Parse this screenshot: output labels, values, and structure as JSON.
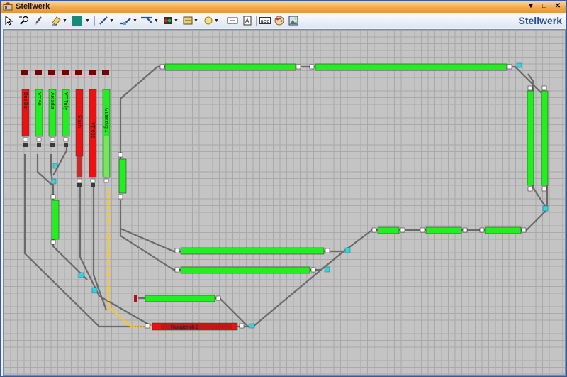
{
  "window": {
    "title": "Stellwerk",
    "minimize_glyph": "▾",
    "maximize_glyph": "□",
    "close_glyph": "✕"
  },
  "toolbar": {
    "app_label": "Stellwerk",
    "tools": [
      {
        "name": "select-pointer-icon"
      },
      {
        "name": "zoom-tool-icon"
      },
      {
        "name": "pencil-icon"
      },
      {
        "name": "eraser-icon"
      },
      {
        "name": "fill-color-icon",
        "color": "#1a8a78"
      },
      {
        "name": "line-tool-icon"
      },
      {
        "name": "track-straight-icon"
      },
      {
        "name": "track-switch-icon"
      },
      {
        "name": "signal-icon"
      },
      {
        "name": "block-icon"
      },
      {
        "name": "circle-icon"
      },
      {
        "name": "text-frame-icon"
      },
      {
        "name": "label-icon"
      },
      {
        "name": "abc-text-icon"
      },
      {
        "name": "palette-icon"
      },
      {
        "name": "image-icon"
      }
    ]
  },
  "colors": {
    "track": "#6a6a6a",
    "free_block": "#22ee22",
    "occupied_block": "#ee1111",
    "route_set": "#ffc41e",
    "switch": "#33d4e0",
    "canvas": "#c4c4c4"
  },
  "blocks": {
    "v1": {
      "label": "Bus Bar",
      "state": "occupied"
    },
    "v2": {
      "label": "VT 98",
      "state": "free"
    },
    "v3": {
      "label": "Arcadia",
      "state": "free"
    },
    "v4": {
      "label": "VT Tully",
      "state": "free"
    },
    "v5": {
      "label": "Stash",
      "state": "occupied"
    },
    "v6": {
      "label": "VT 602",
      "state": "occupied"
    },
    "v7": {
      "label": "Güterzug 1",
      "state": "free"
    },
    "bottom": {
      "label": "Rangierlok 2",
      "state": "occupied"
    }
  }
}
